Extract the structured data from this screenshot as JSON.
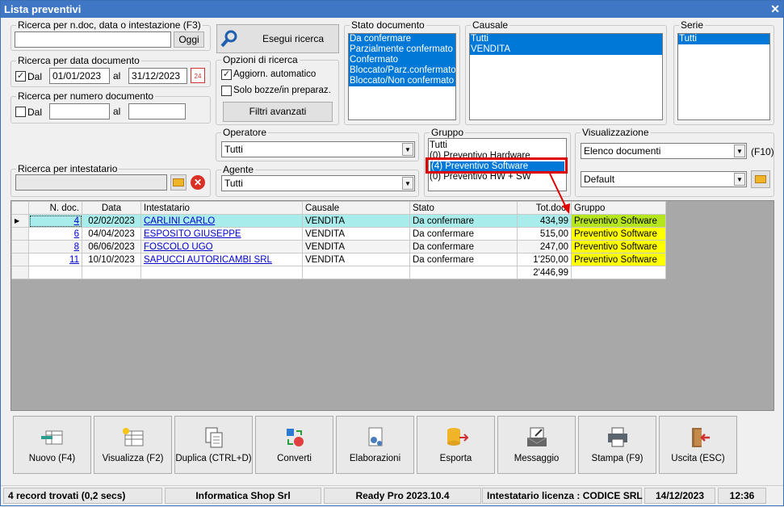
{
  "window": {
    "title": "Lista preventivi",
    "close_glyph": "✕"
  },
  "search_doc": {
    "label": "Ricerca per n.doc, data o intestazione (F3)",
    "value": "",
    "today_label": "Oggi"
  },
  "execute": {
    "label": "Esegui ricerca"
  },
  "search_date": {
    "label": "Ricerca per data documento",
    "dal_label": "Dal",
    "from": "01/01/2023",
    "al_label": "al",
    "to": "31/12/2023",
    "cal_icon_text": "24"
  },
  "search_number": {
    "label": "Ricerca per numero documento",
    "dal_label": "Dal",
    "from": "",
    "al_label": "al",
    "to": ""
  },
  "options": {
    "label": "Opzioni di ricerca",
    "auto_update": "Aggiorn. automatico",
    "drafts": "Solo bozze/in preparaz.",
    "filters_button": "Filtri avanzati"
  },
  "stato": {
    "label": "Stato documento",
    "items": [
      "Da confermare",
      "Parzialmente confermato",
      "Confermato",
      "Bloccato/Parz.confermato",
      "Bloccato/Non confermato"
    ]
  },
  "causale": {
    "label": "Causale",
    "items": [
      "Tutti",
      "VENDITA"
    ]
  },
  "serie": {
    "label": "Serie",
    "items": [
      "Tutti"
    ]
  },
  "operatore": {
    "label": "Operatore",
    "value": "Tutti"
  },
  "agente": {
    "label": "Agente",
    "value": "Tutti"
  },
  "intestatario": {
    "label": "Ricerca per intestatario",
    "value": ""
  },
  "gruppo": {
    "label": "Gruppo",
    "items": [
      "Tutti",
      "(0) Preventivo Hardware",
      "(4) Preventivo Software",
      "(0) Preventivo HW + SW"
    ]
  },
  "visualizzazione": {
    "label": "Visualizzazione",
    "view": "Elenco documenti",
    "f10": "(F10)",
    "layout": "Default"
  },
  "table": {
    "headers": [
      "N. doc.",
      "Data",
      "Intestatario",
      "Causale",
      "Stato",
      "Tot.doc.",
      "Gruppo"
    ],
    "rows": [
      [
        "4",
        "02/02/2023",
        "CARLINI CARLO",
        "VENDITA",
        "Da confermare",
        "434,99",
        "Preventivo Software"
      ],
      [
        "6",
        "04/04/2023",
        "ESPOSITO GIUSEPPE",
        "VENDITA",
        "Da confermare",
        "515,00",
        "Preventivo Software"
      ],
      [
        "8",
        "06/06/2023",
        "FOSCOLO UGO",
        "VENDITA",
        "Da confermare",
        "247,00",
        "Preventivo Software"
      ],
      [
        "11",
        "10/10/2023",
        "SAPUCCI AUTORICAMBI SRL",
        "VENDITA",
        "Da confermare",
        "1'250,00",
        "Preventivo Software"
      ]
    ],
    "total": "2'446,99",
    "row_marker": "▶"
  },
  "buttons": [
    {
      "label": "Nuovo (F4)",
      "icon": "new-icon"
    },
    {
      "label": "Visualizza (F2)",
      "icon": "view-icon"
    },
    {
      "label": "Duplica (CTRL+D)",
      "icon": "duplicate-icon"
    },
    {
      "label": "Converti",
      "icon": "convert-icon"
    },
    {
      "label": "Elaborazioni",
      "icon": "process-icon"
    },
    {
      "label": "Esporta",
      "icon": "export-icon"
    },
    {
      "label": "Messaggio",
      "icon": "message-icon"
    },
    {
      "label": "Stampa (F9)",
      "icon": "print-icon"
    },
    {
      "label": "Uscita (ESC)",
      "icon": "exit-icon"
    }
  ],
  "status": {
    "records": "4 record trovati (0,2 secs)",
    "company": "Informatica Shop Srl",
    "version": "Ready Pro 2023.10.4",
    "license": "Intestatario licenza : CODICE SRL",
    "date": "14/12/2023",
    "time": "12:36"
  },
  "colors": {
    "title_bar": "#3f77c4",
    "selection": "#0078d7",
    "group_cell": "#ffff00",
    "group_cell_current": "#b5e61d",
    "current_row": "#a8ecec",
    "highlight_box": "#e00000"
  }
}
